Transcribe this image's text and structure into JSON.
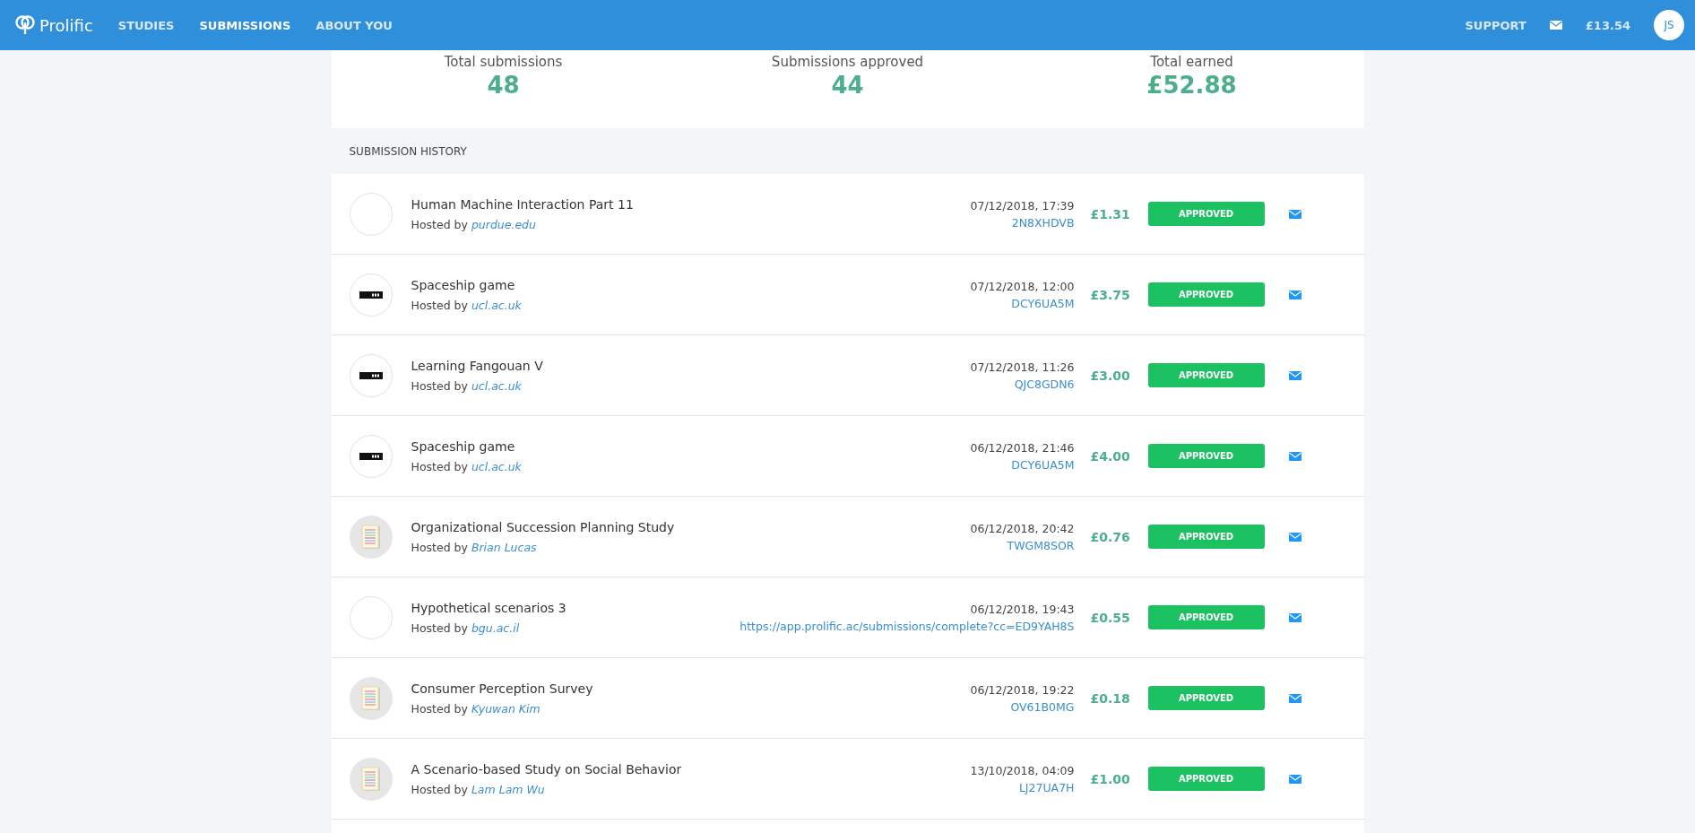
{
  "header": {
    "logo": "Prolific",
    "nav": [
      {
        "label": "STUDIES",
        "selected": false
      },
      {
        "label": "SUBMISSIONS",
        "selected": true
      },
      {
        "label": "ABOUT YOU",
        "selected": false
      }
    ],
    "support": "SUPPORT",
    "balance": "£13.54",
    "avatar_initials": "JS"
  },
  "stats": [
    {
      "label": "Total submissions",
      "value": "48"
    },
    {
      "label": "Submissions approved",
      "value": "44"
    },
    {
      "label": "Total earned",
      "value": "£52.88"
    }
  ],
  "history": {
    "title": "SUBMISSION HISTORY",
    "rows": [
      {
        "kind": "blank",
        "title": "Human Machine Interaction Part 11",
        "hosted_by": "Hosted by",
        "host": "purdue.edu",
        "date": "07/12/2018, 17:39",
        "code": "2N8XHDVB",
        "amount": "£1.31",
        "status": "APPROVED"
      },
      {
        "kind": "ucl",
        "title": "Spaceship game",
        "hosted_by": "Hosted by",
        "host": "ucl.ac.uk",
        "date": "07/12/2018, 12:00",
        "code": "DCY6UA5M",
        "amount": "£3.75",
        "status": "APPROVED"
      },
      {
        "kind": "ucl",
        "title": "Learning Fangouan V",
        "hosted_by": "Hosted by",
        "host": "ucl.ac.uk",
        "date": "07/12/2018, 11:26",
        "code": "QJC8GDN6",
        "amount": "£3.00",
        "status": "APPROVED"
      },
      {
        "kind": "ucl",
        "title": "Spaceship game",
        "hosted_by": "Hosted by",
        "host": "ucl.ac.uk",
        "date": "06/12/2018, 21:46",
        "code": "DCY6UA5M",
        "amount": "£4.00",
        "status": "APPROVED"
      },
      {
        "kind": "document",
        "title": "Organizational Succession Planning Study",
        "hosted_by": "Hosted by",
        "host": "Brian Lucas",
        "date": "06/12/2018, 20:42",
        "code": "TWGM8SOR",
        "amount": "£0.76",
        "status": "APPROVED"
      },
      {
        "kind": "blank",
        "title": "Hypothetical scenarios 3",
        "hosted_by": "Hosted by",
        "host": "bgu.ac.il",
        "date": "06/12/2018, 19:43",
        "code": "https://app.prolific.ac/submissions/complete?cc=ED9YAH8S",
        "amount": "£0.55",
        "status": "APPROVED"
      },
      {
        "kind": "document",
        "title": "Consumer Perception Survey",
        "hosted_by": "Hosted by",
        "host": "Kyuwan Kim",
        "date": "06/12/2018, 19:22",
        "code": "OV61B0MG",
        "amount": "£0.18",
        "status": "APPROVED"
      },
      {
        "kind": "document",
        "title": "A Scenario-based Study on Social Behavior",
        "hosted_by": "Hosted by",
        "host": "Lam Lam Wu",
        "date": "13/10/2018, 04:09",
        "code": "LJ27UA7H",
        "amount": "£1.00",
        "status": "APPROVED"
      }
    ]
  }
}
